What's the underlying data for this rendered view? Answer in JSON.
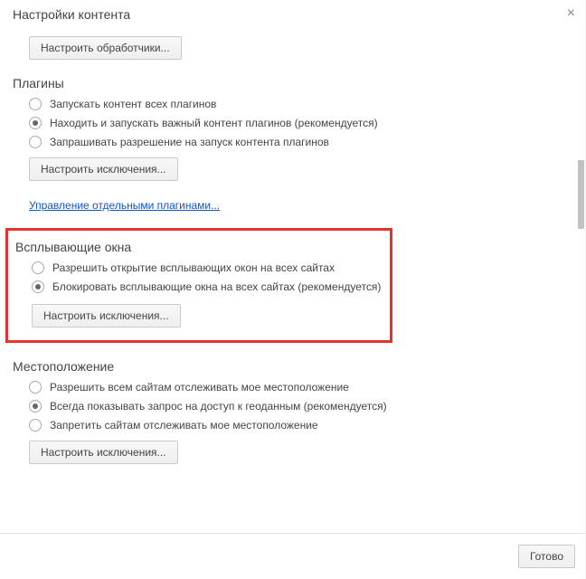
{
  "header": {
    "title": "Настройки контента"
  },
  "handlers": {
    "configure_label": "Настроить обработчики..."
  },
  "plugins": {
    "title": "Плагины",
    "options": [
      {
        "label": "Запускать контент всех плагинов",
        "selected": false
      },
      {
        "label": "Находить и запускать важный контент плагинов (рекомендуется)",
        "selected": true
      },
      {
        "label": "Запрашивать разрешение на запуск контента плагинов",
        "selected": false
      }
    ],
    "exceptions_label": "Настроить исключения...",
    "manage_link": "Управление отдельными плагинами..."
  },
  "popups": {
    "title": "Всплывающие окна",
    "options": [
      {
        "label": "Разрешить открытие всплывающих окон на всех сайтах",
        "selected": false
      },
      {
        "label": "Блокировать всплывающие окна на всех сайтах (рекомендуется)",
        "selected": true
      }
    ],
    "exceptions_label": "Настроить исключения..."
  },
  "location": {
    "title": "Местоположение",
    "options": [
      {
        "label": "Разрешить всем сайтам отслеживать мое местоположение",
        "selected": false
      },
      {
        "label": "Всегда показывать запрос на доступ к геоданным (рекомендуется)",
        "selected": true
      },
      {
        "label": "Запретить сайтам отслеживать мое местоположение",
        "selected": false
      }
    ],
    "exceptions_label": "Настроить исключения..."
  },
  "footer": {
    "done_label": "Готово"
  }
}
